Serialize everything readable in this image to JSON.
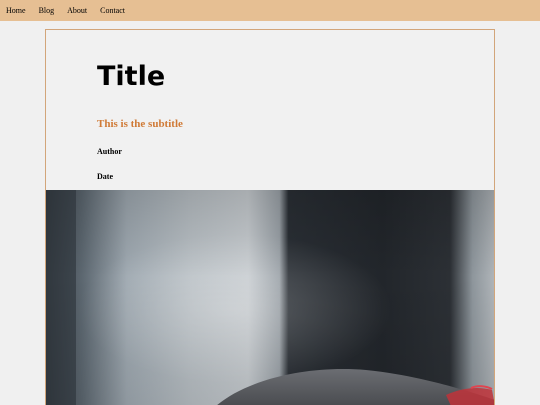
{
  "nav": {
    "items": [
      {
        "label": "Home"
      },
      {
        "label": "Blog"
      },
      {
        "label": "About"
      },
      {
        "label": "Contact"
      }
    ]
  },
  "article": {
    "title": "Title",
    "subtitle": "This is the subtitle",
    "author": "Author",
    "date": "Date"
  },
  "colors": {
    "navbar": "#e6bf93",
    "subtitle": "#d07a36",
    "card_border": "#d2a57a",
    "page_background": "#f0f0f0"
  }
}
